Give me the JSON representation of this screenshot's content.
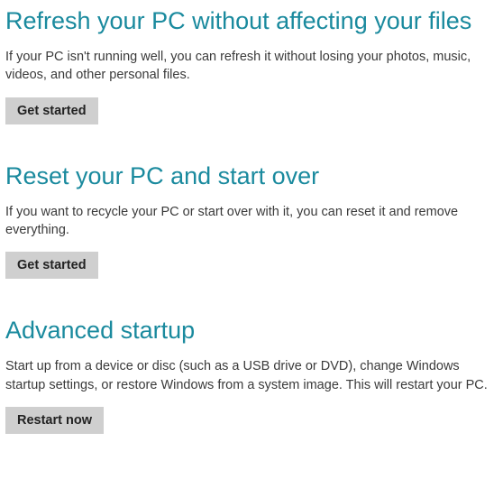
{
  "sections": [
    {
      "heading": "Refresh your PC without affecting your files",
      "description": "If your PC isn't running well, you can refresh it without losing your photos, music, videos, and other personal files.",
      "button": "Get started"
    },
    {
      "heading": "Reset your PC and start over",
      "description": "If you want to recycle your PC or start over with it, you can reset it and remove everything.",
      "button": "Get started"
    },
    {
      "heading": "Advanced startup",
      "description": "Start up from a device or disc (such as a USB drive or DVD), change Windows startup settings, or restore Windows from a system image. This will restart your PC.",
      "button": "Restart now"
    }
  ]
}
